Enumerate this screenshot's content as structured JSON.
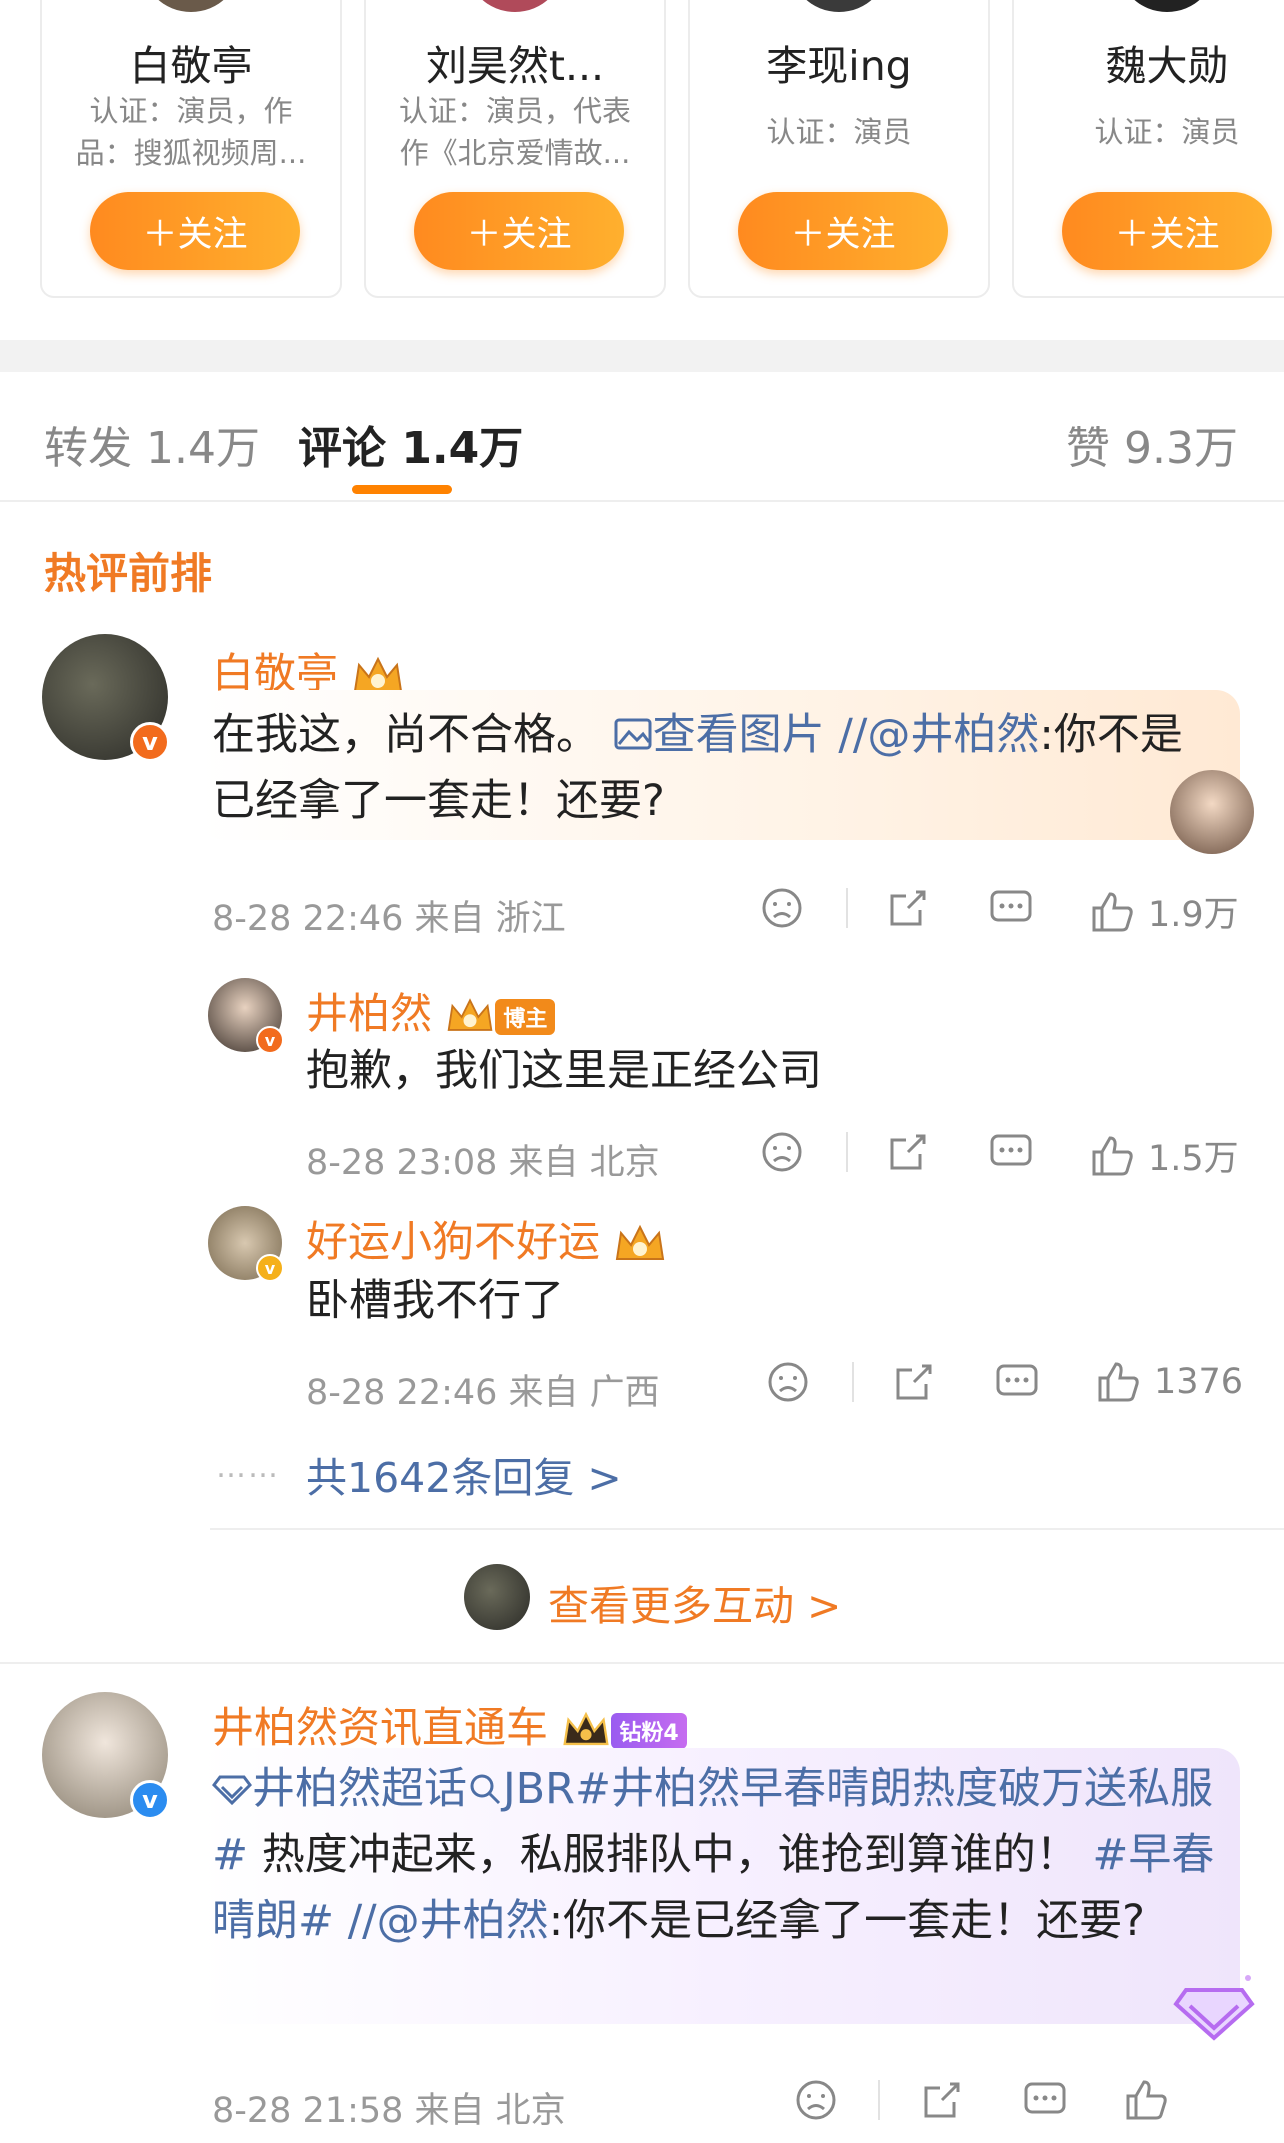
{
  "recommend": [
    {
      "name": "白敬亭",
      "desc": "认证：演员，作品：搜狐视频周...",
      "follow": "＋关注"
    },
    {
      "name": "刘昊然t...",
      "desc": "认证：演员，代表作《北京爱情故...",
      "follow": "＋关注"
    },
    {
      "name": "李现ing",
      "desc": "认证：演员",
      "follow": "＋关注"
    },
    {
      "name": "魏大勋",
      "desc": "认证：演员",
      "follow": "＋关注"
    }
  ],
  "tabs": {
    "repost": "转发 1.4万",
    "comment": "评论 1.4万",
    "like": "赞 9.3万"
  },
  "hot_title": "热评前排",
  "colors": {
    "accent": "#ff8200",
    "username": "#f07a24",
    "link": "#4c6ea6"
  },
  "comments": [
    {
      "user": "白敬亭",
      "text_main": "在我这，尚不合格。",
      "img_link": "查看图片",
      "mention": "//@井柏然",
      "text_tail": ":你不是已经拿了一套走！还要?",
      "time": "8-28 22:46 来自 浙江",
      "likes": "1.9万",
      "replies": [
        {
          "user": "井柏然",
          "badge": "博主",
          "text": "抱歉，我们这里是正经公司",
          "time": "8-28 23:08 来自 北京",
          "likes": "1.5万"
        },
        {
          "user": "好运小狗不好运",
          "text": "卧槽我不行了",
          "time": "8-28 22:46 来自 广西",
          "likes": "1376"
        }
      ],
      "more_replies": "共1642条回复 >",
      "more_interact": "查看更多互动 >"
    },
    {
      "user": "井柏然资讯直通车",
      "badge": "钻粉4",
      "topic": "井柏然超话",
      "tag1": "JBR#井柏然早春晴朗热度破万送私服#",
      "text_mid": " 热度冲起来，私服排队中，谁抢到算谁的！",
      "tag2": "#早春晴朗#",
      "mention": " //@井柏然",
      "text_tail": ":你不是已经拿了一套走！还要?",
      "time": "8-28 21:58 来自 北京"
    }
  ],
  "icons": [
    "sad-face-icon",
    "share-icon",
    "comment-icon",
    "like-icon",
    "image-icon",
    "diamond-icon",
    "search-icon",
    "crown-icon"
  ]
}
